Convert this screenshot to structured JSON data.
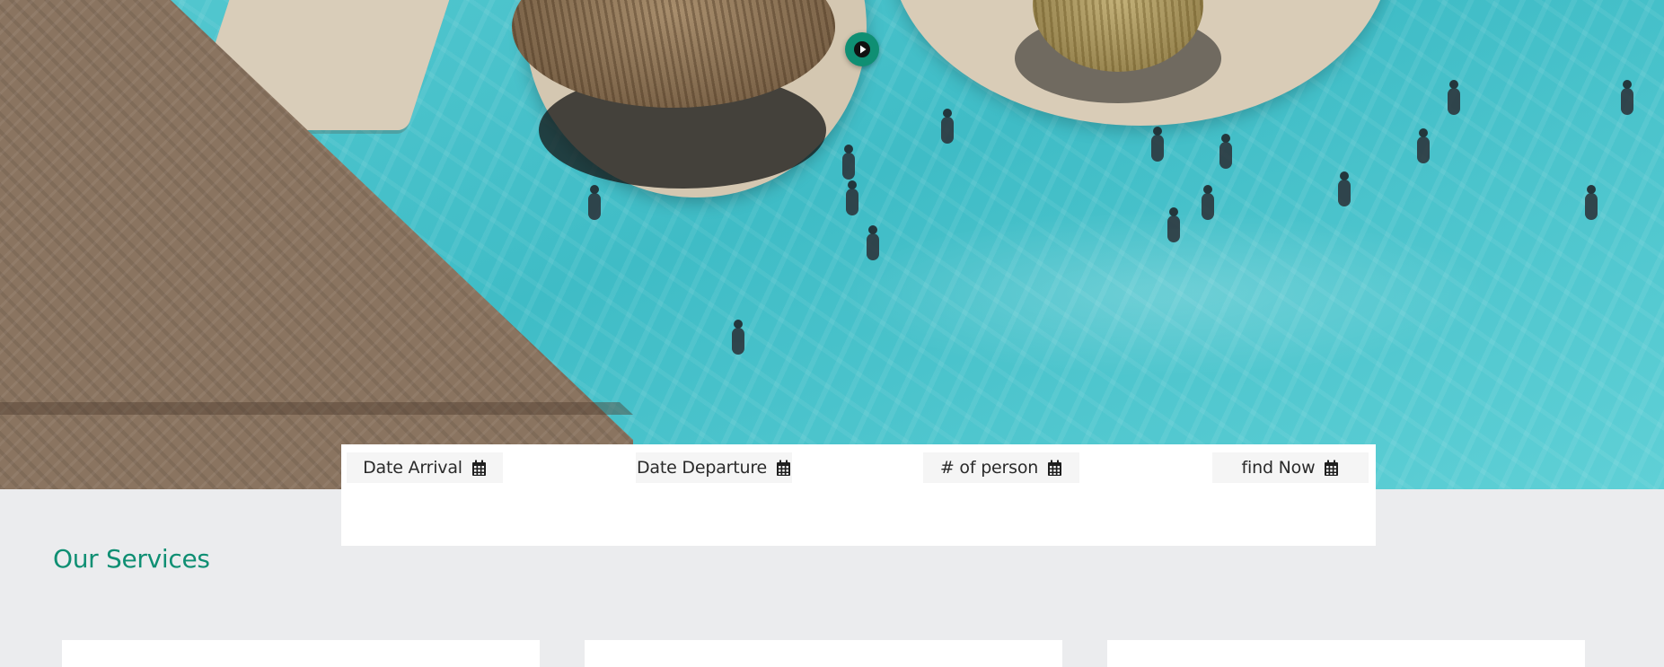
{
  "hero": {
    "media": "aerial resort pool video",
    "play_icon": "play-icon",
    "accent_color": "#0f8f73"
  },
  "booking": {
    "fields": [
      {
        "label": "Date Arrival",
        "icon": "calendar-icon"
      },
      {
        "label": "Date Departure",
        "icon": "calendar-icon"
      },
      {
        "label": "# of person",
        "icon": "calendar-icon"
      },
      {
        "label": "find Now",
        "icon": "calendar-icon"
      }
    ]
  },
  "services": {
    "title": "Our Services",
    "title_color": "#0f8f73"
  }
}
